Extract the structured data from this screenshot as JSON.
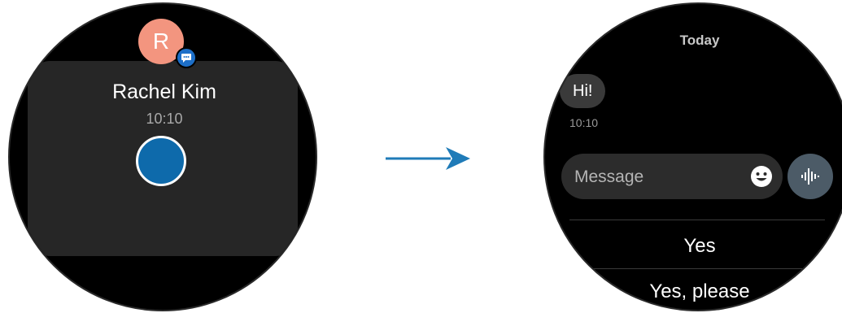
{
  "notification": {
    "avatar_letter": "R",
    "sender_name": "Rachel Kim",
    "time": "10:10",
    "avatar_color": "#f3957f",
    "badge_icon": "message-bubble-icon",
    "record_icon": "record-button"
  },
  "conversation": {
    "date_header": "Today",
    "messages": [
      {
        "text": "Hi!",
        "time": "10:10"
      }
    ],
    "input_placeholder": "Message",
    "emoji_icon": "emoji-icon",
    "voice_icon": "voice-input-icon",
    "quick_replies": [
      "Yes",
      "Yes, please"
    ]
  },
  "arrow_icon": "arrow-right-icon",
  "colors": {
    "accent_blue": "#0e6aab",
    "arrow": "#1f7bb8",
    "voice_button": "#4c5b67"
  }
}
